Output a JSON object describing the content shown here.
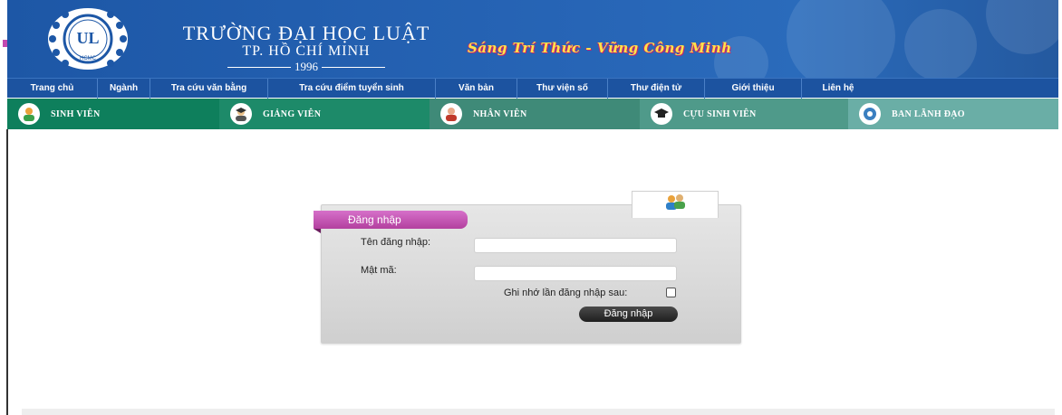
{
  "header": {
    "title_main": "TRƯỜNG ĐẠI HỌC LUẬT",
    "title_sub": "TP. HỒ CHÍ MINH",
    "title_year": "1996",
    "slogan": "Sáng Trí Thức - Vững Công Minh",
    "logo_text": "HCMC",
    "logo_monogram": "UL",
    "colors": {
      "header_bg": "#1d57a6",
      "slogan": "#ffe34a",
      "slogan_outline": "#c2256d"
    }
  },
  "topnav": {
    "items": [
      {
        "label": "Trang chủ"
      },
      {
        "label": "Ngành"
      },
      {
        "label": "Tra cứu văn bằng"
      },
      {
        "label": "Tra cứu điểm tuyển sinh"
      },
      {
        "label": "Văn bản"
      },
      {
        "label": "Thư viện số"
      },
      {
        "label": "Thư điện tử"
      },
      {
        "label": "Giới thiệu"
      },
      {
        "label": "Liên hệ"
      }
    ]
  },
  "rolenav": {
    "items": [
      {
        "label": "SINH VIÊN",
        "icon": "student-icon",
        "color": "#0e7f5c"
      },
      {
        "label": "GIẢNG VIÊN",
        "icon": "lecturer-icon",
        "color": "#1d8a69"
      },
      {
        "label": "NHÂN VIÊN",
        "icon": "staff-icon",
        "color": "#3f8a78"
      },
      {
        "label": "CỰU SINH VIÊN",
        "icon": "graduation-cap-icon",
        "color": "#4f9a8a"
      },
      {
        "label": "BAN LÃNH ĐẠO",
        "icon": "leadership-icon",
        "color": "#6aaea6"
      }
    ]
  },
  "login": {
    "tab_label": "Đăng nhập",
    "username_label": "Tên đăng nhập:",
    "username_value": "",
    "password_label": "Mật mã:",
    "password_value": "",
    "remember_label": "Ghi nhớ lần đăng nhập sau:",
    "remember_checked": false,
    "submit_label": "Đăng nhập",
    "users_icon": "users-icon"
  }
}
